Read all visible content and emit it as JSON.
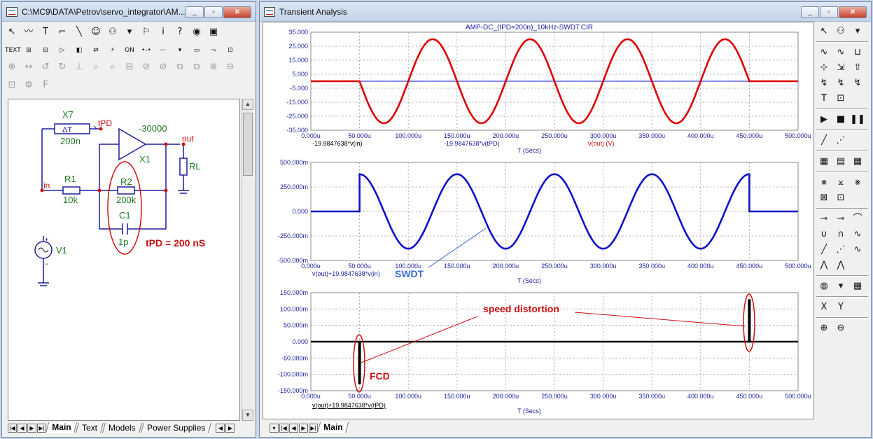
{
  "left_window": {
    "title": "C:\\MC9\\DATA\\Petrov\\servo_integrator\\AM...",
    "controls": [
      "_",
      "▫",
      "✕"
    ],
    "toolbar1": [
      "↖",
      "〰",
      "T",
      "⌐",
      "╲",
      "☺",
      "⚇",
      "▾",
      "⚐",
      "i",
      "?",
      "◉",
      "▣"
    ],
    "toolbar2": [
      "TEXT",
      "⊞",
      "⊟",
      "▷",
      "◧",
      "⇄",
      "⚡",
      "ON",
      "•-•",
      "⋯",
      "▾",
      "▭",
      "⤳",
      "⊡"
    ],
    "toolbar3": [
      "⊕",
      "↔",
      "↺",
      "↻",
      "⊥",
      "⌕",
      "⌕",
      "⊟",
      "⊘",
      "⊘",
      "⧉",
      "⧉",
      "⊕",
      "⊖"
    ],
    "toolbar4": [
      "⊡",
      "⚙",
      "F"
    ],
    "tabs": [
      "Main",
      "Text",
      "Models",
      "Power Supplies"
    ]
  },
  "schematic": {
    "parts": {
      "x7": "X7",
      "delay_symbol": "ΔT",
      "x7_value": "200n",
      "tpd_node": "tPD",
      "gain": "-30000",
      "out_node": "out",
      "x1": "X1",
      "rl": "RL",
      "in_node": "in",
      "r1": "R1",
      "r1_value": "10k",
      "r2": "R2",
      "r2_value": "200k",
      "c1": "C1",
      "c1_value": "1p",
      "v1": "V1",
      "plus": "+",
      "minus": "-"
    },
    "annotation": "tPD = 200 nS",
    "colors": {
      "wire": "#1e1ea0",
      "label": "#1f7a1f",
      "node": "#cc1111",
      "circle": "#cc1111"
    }
  },
  "right_window": {
    "title": "Transient Analysis",
    "controls": [
      "_",
      "▫",
      "✕"
    ],
    "tabs": [
      "Main"
    ],
    "plot_title": "AMP-DC_(tPD=200n)_10kHz-SWDT.CIR",
    "x_ticks": [
      "0.000u",
      "50.000u",
      "100.000u",
      "150.000u",
      "200.000u",
      "250.000u",
      "300.000u",
      "350.000u",
      "400.000u",
      "450.000u",
      "500.000u"
    ],
    "toolbar": {
      "row1": [
        "↖",
        "⚇",
        "▾"
      ],
      "row2": [
        "∿",
        "∿",
        "⊔"
      ],
      "row3": [
        "⊹",
        "⇲",
        "⇧"
      ],
      "row4": [
        "↯",
        "↯",
        "↯"
      ],
      "row5": [
        "T",
        "⊡"
      ],
      "row6": [
        "▶",
        "■",
        "❚❚"
      ],
      "row7": [
        "╱",
        "⋰"
      ],
      "row8": [
        "▦",
        "▤",
        "▦"
      ],
      "row9": [
        "⨳",
        "⨲",
        "⨳"
      ],
      "row10": [
        "⊠",
        "⊡"
      ],
      "row11": [
        "⊸",
        "⊸",
        "⌒"
      ],
      "row12": [
        "∪",
        "∩",
        "∿"
      ],
      "row13": [
        "╱",
        "⋰",
        "∿"
      ],
      "row14": [
        "⋀",
        "⋀"
      ],
      "row15": [
        "◍",
        "▾",
        "▦"
      ],
      "row16": [
        "X",
        "Y"
      ],
      "row17": [
        "⊕",
        "⊖"
      ]
    }
  },
  "chart_data": [
    {
      "type": "line",
      "title": "AMP-DC_(tPD=200n)_10kHz-SWDT.CIR",
      "xlabel": "T (Secs)",
      "xlim": [
        0,
        500
      ],
      "x_unit": "u",
      "ylim": [
        -35,
        35
      ],
      "y_ticks": [
        "35.000",
        "25.000",
        "15.000",
        "5.000",
        "-5.000",
        "-15.000",
        "-25.000",
        "-35.000"
      ],
      "grid": true,
      "series": [
        {
          "name": "-19.9847638*v(in)",
          "color": "#1010d0",
          "x": [
            0,
            500
          ],
          "values": [
            0,
            0
          ]
        },
        {
          "name": "-19.9847638*v(tPD)",
          "color": "#1010d0",
          "x": [
            0,
            500
          ],
          "values": [
            0,
            0
          ]
        },
        {
          "name": "v(out) (V)",
          "color": "#dd0000",
          "function": "sine",
          "x_range": [
            50,
            450
          ],
          "amplitude": 30,
          "period": 100,
          "phase_sign": -1
        }
      ]
    },
    {
      "type": "line",
      "xlabel": "T (Secs)",
      "xlim": [
        0,
        500
      ],
      "ylim": [
        -500,
        500
      ],
      "y_ticks": [
        "500.000m",
        "250.000m",
        "0.000",
        "-250.000m",
        "-500.000m"
      ],
      "grid": true,
      "series": [
        {
          "name": "v(out)+19.9847638*v(in)",
          "color": "#1010c8",
          "function": "cos",
          "x_range": [
            50,
            450
          ],
          "amplitude": 380,
          "period": 100
        }
      ],
      "annotations": [
        {
          "text": "SWDT",
          "color": "#3a6cd0"
        }
      ]
    },
    {
      "type": "line",
      "xlabel": "T (Secs)",
      "xlim": [
        0,
        500
      ],
      "ylim": [
        -150,
        150
      ],
      "y_ticks": [
        "150.000m",
        "100.000m",
        "50.000m",
        "0.000",
        "-50.000m",
        "-100.000m",
        "-150.000m"
      ],
      "grid": true,
      "series": [
        {
          "name": "v(out)+19.9847638*v(tPD)",
          "color": "#000000",
          "spikes": [
            {
              "x": 50,
              "from": 0,
              "to": -130
            },
            {
              "x": 450,
              "from": 0,
              "to": 130
            }
          ]
        }
      ],
      "annotations": [
        {
          "text": "speed distortion",
          "color": "#cc1111"
        },
        {
          "text": "FCD",
          "color": "#cc1111"
        }
      ]
    }
  ]
}
